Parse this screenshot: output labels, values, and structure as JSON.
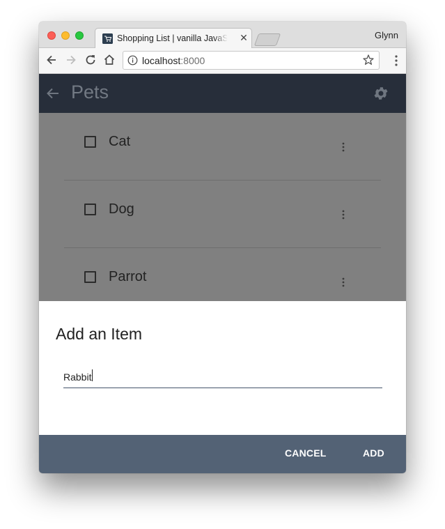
{
  "browser": {
    "tab_title": "Shopping List | vanilla JavaScript",
    "tab_icon": "cart-icon",
    "profile_name": "Glynn",
    "url_host": "localhost",
    "url_port": ":8000",
    "buttons": [
      "back",
      "forward",
      "reload",
      "home"
    ]
  },
  "app": {
    "title": "Pets",
    "header_color": "#272e3a",
    "items": [
      {
        "label": "Cat",
        "checked": false
      },
      {
        "label": "Dog",
        "checked": false
      },
      {
        "label": "Parrot",
        "checked": false
      }
    ]
  },
  "dialog": {
    "title": "Add an Item",
    "input_value": "Rabbit",
    "cancel_label": "CANCEL",
    "add_label": "ADD",
    "actions_color": "#536275"
  }
}
